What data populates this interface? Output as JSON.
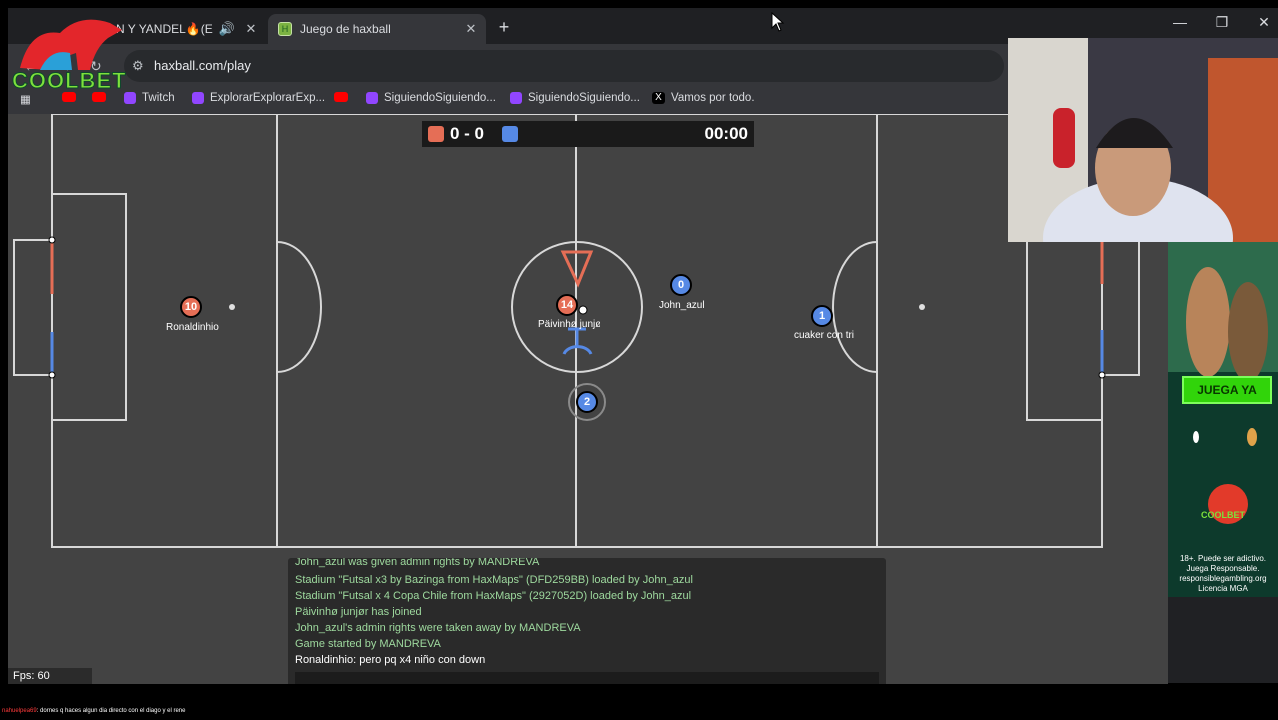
{
  "browser": {
    "tabs": [
      {
        "title": "N Y YANDEL🔥(E",
        "active": false
      },
      {
        "title": "Juego de haxball",
        "active": true
      }
    ],
    "favicon_letter": "H",
    "url": "haxball.com/play",
    "bookmarks": [
      {
        "label": "",
        "icon": "youtube-icon"
      },
      {
        "label": "",
        "icon": "youtube-icon"
      },
      {
        "label": "Twitch",
        "icon": "twitch-icon"
      },
      {
        "label": "ExplorarExplorarExp...",
        "icon": "twitch-icon"
      },
      {
        "label": "",
        "icon": "youtube-icon"
      },
      {
        "label": "SiguiendoSiguiendo...",
        "icon": "twitch-icon"
      },
      {
        "label": "SiguiendoSiguiendo...",
        "icon": "twitch-icon"
      },
      {
        "label": "Vamos por todo.",
        "icon": "x-icon"
      }
    ]
  },
  "game": {
    "score": "0 - 0",
    "time": "00:00",
    "team_colors": {
      "red": "#e56e56",
      "blue": "#5689e5"
    },
    "players": [
      {
        "team": "red",
        "number": "10",
        "name": "Ronaldinhio"
      },
      {
        "team": "red",
        "number": "14",
        "name": "Päivinhø junjø"
      },
      {
        "team": "blue",
        "number": "0",
        "name": "John_azul"
      },
      {
        "team": "blue",
        "number": "1",
        "name": "cuaker con tri"
      },
      {
        "team": "blue",
        "number": "2",
        "name": ""
      }
    ],
    "fps": "Fps: 60"
  },
  "chat": {
    "lines": [
      {
        "text": "John_azul was given admin rights by MANDREVA",
        "type": "system"
      },
      {
        "text": "Stadium \"Futsal x3 by Bazinga from HaxMaps\" (DFD259BB) loaded by John_azul",
        "type": "system"
      },
      {
        "text": "Stadium \"Futsal  x 4 Copa Chile from HaxMaps\" (2927052D) loaded by John_azul",
        "type": "system"
      },
      {
        "text": "Päivinhø junjør has joined",
        "type": "system"
      },
      {
        "text": "John_azul's admin rights were taken away by MANDREVA",
        "type": "system"
      },
      {
        "text": "Game started by MANDREVA",
        "type": "system"
      },
      {
        "text": "Ronaldinhio: pero pq x4 niño con down",
        "type": "user"
      }
    ]
  },
  "overlay": {
    "logo_text": "COOLBET",
    "ad": {
      "cta": "JUEGA YA",
      "brand": "COOLBET",
      "disclaimer": "18+. Puede ser adictivo. Juega Responsable. responsiblegambling.org Licencia MGA"
    },
    "stream_chat": {
      "user": "nahuelpea69",
      "message": ": dornes q haces algun dia directo con el diago y el rene"
    }
  }
}
